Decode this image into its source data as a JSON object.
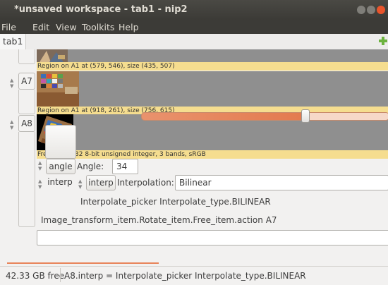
{
  "window": {
    "title": "*unsaved workspace - tab1 - nip2"
  },
  "menu": [
    "File",
    "Edit",
    "View",
    "Toolkits",
    "Help"
  ],
  "tabs": [
    {
      "label": "tab1"
    }
  ],
  "rows": {
    "top_caption": "Region on A1 at (579, 546), size (435, 507)",
    "a7": {
      "label": "A7",
      "caption": "Region on A1 at (918, 261), size (756, 615)"
    },
    "a8": {
      "label": "A8",
      "caption": "Free, 971x932 8-bit unsigned integer, 3 bands, sRGB",
      "angle": {
        "button": "angle",
        "label": "Angle:",
        "value": "34",
        "slider_fraction": 0.66
      },
      "interp": {
        "button": "interp",
        "inner_button": "interp",
        "label": "Interpolation:",
        "value": "Bilinear",
        "desc": "Interpolate_picker Interpolate_type.BILINEAR"
      },
      "action": "Image_transform_item.Rotate_item.Free_item.action A7"
    }
  },
  "status": {
    "free": "42.33 GB free",
    "message": "A8.interp = Interpolate_picker Interpolate_type.BILINEAR"
  },
  "colors": {
    "titlebar": "#3c3b37",
    "caption_bg": "#f5dd8f",
    "accent": "#e37a4e",
    "thumb_bg": "#8f8f8f"
  }
}
